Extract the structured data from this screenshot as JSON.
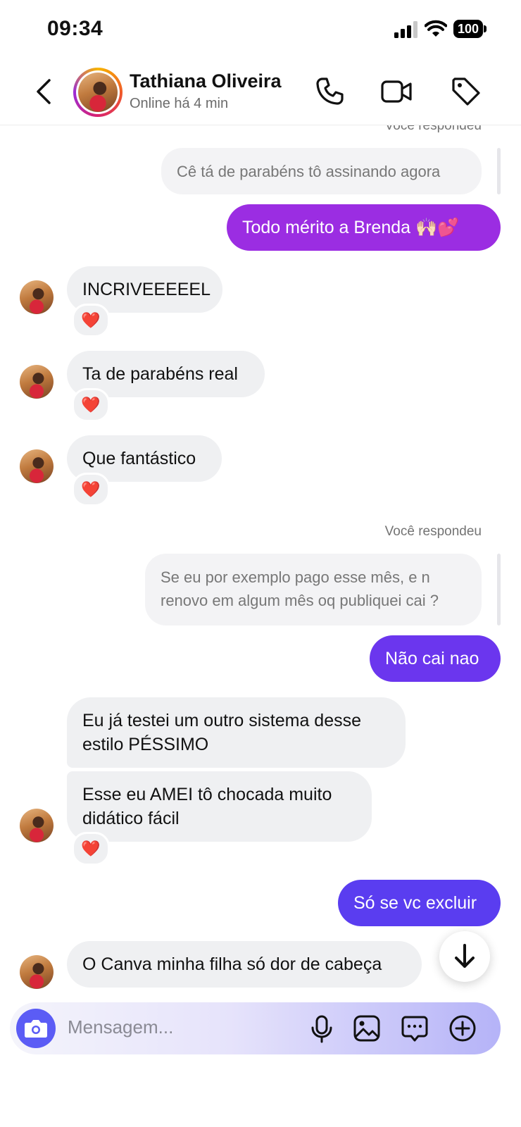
{
  "status_bar": {
    "time": "09:34",
    "battery": "100"
  },
  "header": {
    "name": "Tathiana Oliveira",
    "status": "Online há 4 min"
  },
  "messages": {
    "top_reply_label": "Você respondeu",
    "top_quote": "Cê tá de parabéns tô assinando agora",
    "out1": "Todo mérito a Brenda 🙌🏻💕",
    "in1": "INCRIVEEEEEL",
    "in2": "Ta de parabéns real",
    "in3": "Que fantástico",
    "reply_label": "Você respondeu",
    "quote_line1": "Se eu por exemplo pago esse mês, e n",
    "quote_line2": "renovo em algum mês oq publiquei cai ?",
    "out2": "Não cai nao",
    "in4_line1": "Eu já testei um outro sistema desse",
    "in4_line2": "estilo PÉSSIMO",
    "in5_line1": "Esse eu AMEI tô chocada muito",
    "in5_line2": "didático fácil",
    "out3": "Só se vc excluir",
    "in6": "O Canva minha filha só dor de cabeça",
    "reaction": "❤️"
  },
  "composer": {
    "placeholder": "Mensagem..."
  },
  "colors": {
    "out_purple": "#9b2de2",
    "out_violet": "#6b36ee",
    "out_indigo": "#5a3df0",
    "camera_blue": "#5b5cf5"
  },
  "icons": [
    "back-icon",
    "phone-icon",
    "video-icon",
    "tag-icon",
    "camera-icon",
    "mic-icon",
    "image-icon",
    "sticker-icon",
    "plus-icon",
    "arrow-down-icon"
  ]
}
